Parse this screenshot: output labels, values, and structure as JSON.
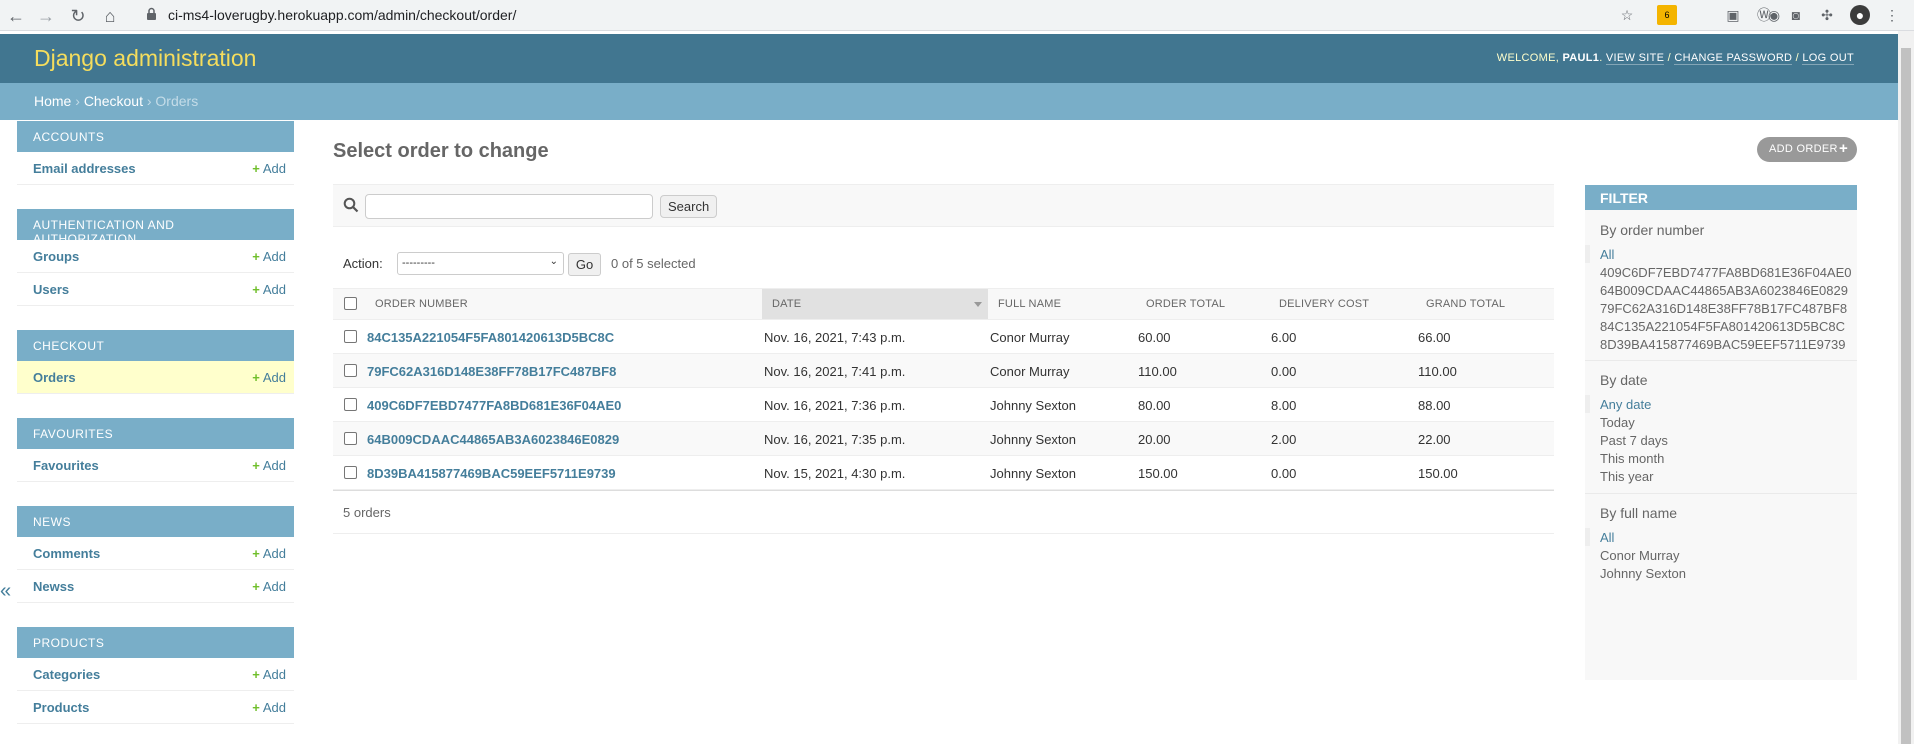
{
  "browser": {
    "url": "ci-ms4-loverugby.herokuapp.com/admin/checkout/order/",
    "ext_badge": "6"
  },
  "header": {
    "brand": "Django administration",
    "welcome": "WELCOME,",
    "username": "PAUL1",
    "view_site": "VIEW SITE",
    "change_password": "CHANGE PASSWORD",
    "log_out": "LOG OUT"
  },
  "breadcrumbs": {
    "home": "Home",
    "app": "Checkout",
    "current": "Orders",
    "sep": "›"
  },
  "sidebar": {
    "collapse": "«",
    "add_label": "Add",
    "modules": [
      {
        "title": "Accounts",
        "models": [
          "Email addresses"
        ]
      },
      {
        "title": "Authentication and Authorization",
        "models": [
          "Groups",
          "Users"
        ]
      },
      {
        "title": "Checkout",
        "models": [
          "Orders"
        ]
      },
      {
        "title": "Favourites",
        "models": [
          "Favourites"
        ]
      },
      {
        "title": "News",
        "models": [
          "Comments",
          "Newss"
        ]
      },
      {
        "title": "Products",
        "models": [
          "Categories",
          "Products"
        ]
      }
    ]
  },
  "main": {
    "title": "Select order to change",
    "add_button": "ADD ORDER",
    "search_button": "Search",
    "action_label": "Action:",
    "action_selected": "---------",
    "go_button": "Go",
    "selection_counter": "0 of 5 selected",
    "columns": [
      "Order number",
      "Date",
      "Full name",
      "Order total",
      "Delivery cost",
      "Grand total"
    ],
    "rows": [
      [
        "84C135A221054F5FA801420613D5BC8C",
        "Nov. 16, 2021, 7:43 p.m.",
        "Conor Murray",
        "60.00",
        "6.00",
        "66.00"
      ],
      [
        "79FC62A316D148E38FF78B17FC487BF8",
        "Nov. 16, 2021, 7:41 p.m.",
        "Conor Murray",
        "110.00",
        "0.00",
        "110.00"
      ],
      [
        "409C6DF7EBD7477FA8BD681E36F04AE0",
        "Nov. 16, 2021, 7:36 p.m.",
        "Johnny Sexton",
        "80.00",
        "8.00",
        "88.00"
      ],
      [
        "64B009CDAAC44865AB3A6023846E0829",
        "Nov. 16, 2021, 7:35 p.m.",
        "Johnny Sexton",
        "20.00",
        "2.00",
        "22.00"
      ],
      [
        "8D39BA415877469BAC59EEF5711E9739",
        "Nov. 15, 2021, 4:30 p.m.",
        "Johnny Sexton",
        "150.00",
        "0.00",
        "150.00"
      ]
    ],
    "paginator": "5 orders"
  },
  "filter": {
    "title": "FILTER",
    "groups": [
      {
        "heading": "By order number",
        "options": [
          "All",
          "409C6DF7EBD7477FA8BD681E36F04AE0",
          "64B009CDAAC44865AB3A6023846E0829",
          "79FC62A316D148E38FF78B17FC487BF8",
          "84C135A221054F5FA801420613D5BC8C",
          "8D39BA415877469BAC59EEF5711E9739"
        ]
      },
      {
        "heading": "By date",
        "options": [
          "Any date",
          "Today",
          "Past 7 days",
          "This month",
          "This year"
        ]
      },
      {
        "heading": "By full name",
        "options": [
          "All",
          "Conor Murray",
          "Johnny Sexton"
        ]
      }
    ]
  },
  "colors": {
    "header": "#417690",
    "breadcrumbs": "#79aec8",
    "brand": "#f5dd5d",
    "link": "#447e9b",
    "add_plus": "#70bf2b"
  }
}
